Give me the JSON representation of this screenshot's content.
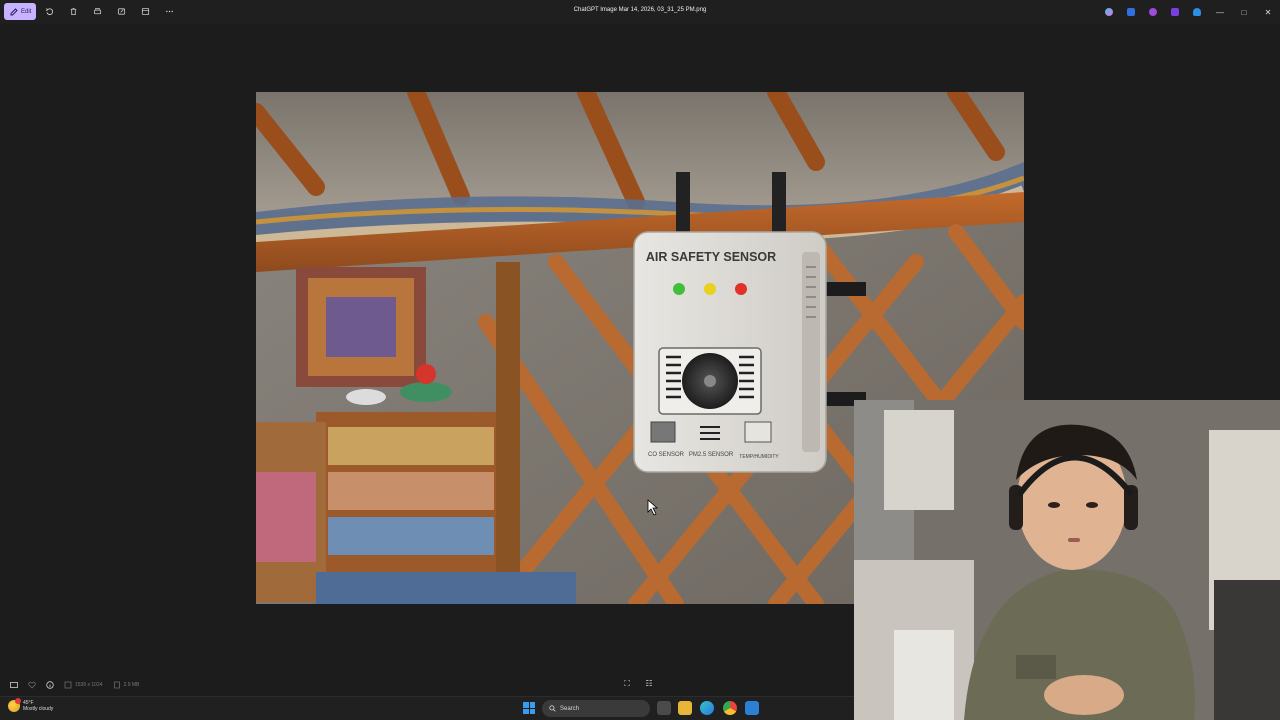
{
  "window": {
    "title": "ChatGPT Image Mar 14, 2026, 03_31_25 PM.png",
    "edit_label": "Edit"
  },
  "toolbar": {
    "tools": [
      "rotate-icon",
      "delete-icon",
      "print-icon",
      "share-icon",
      "info-icon",
      "more-icon"
    ]
  },
  "image": {
    "sensor_title": "AIR SAFETY SENSOR",
    "sensor_labels": [
      "CO SENSOR",
      "PM2.5 SENSOR",
      "TEMP/HUMIDITY"
    ],
    "led_colors": [
      "#3fbf3a",
      "#e9d21f",
      "#e23227"
    ]
  },
  "statusbar": {
    "dimensions": "1536 x 1024",
    "file_size": "2.9 MB"
  },
  "taskbar": {
    "temperature": "45°F",
    "weather": "Mostly cloudy",
    "search_placeholder": "Search"
  },
  "colors": {
    "accent": "#c7b3ff",
    "background": "#1c1c1c"
  }
}
